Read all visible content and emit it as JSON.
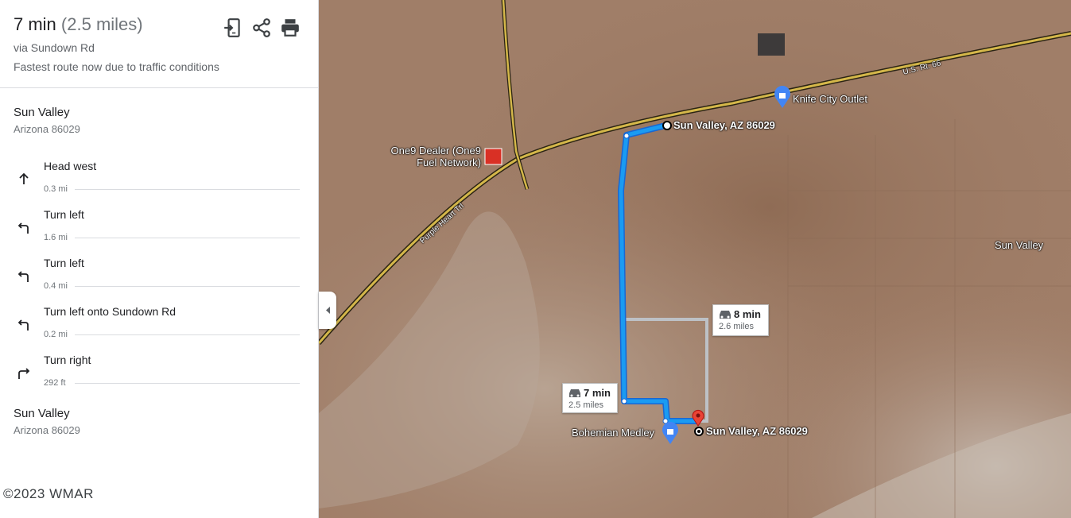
{
  "summary": {
    "time": "7 min",
    "distance": "(2.5 miles)",
    "via": "via Sundown Rd",
    "note": "Fastest route now due to traffic conditions"
  },
  "header_icons": [
    "send-to-phone-icon",
    "share-icon",
    "print-icon"
  ],
  "origin": {
    "name": "Sun Valley",
    "address": "Arizona 86029"
  },
  "steps": [
    {
      "icon": "arrow-up-icon",
      "instruction": "Head west",
      "distance": "0.3 mi"
    },
    {
      "icon": "turn-left-icon",
      "instruction": "Turn left",
      "distance": "1.6 mi"
    },
    {
      "icon": "turn-left-icon",
      "instruction": "Turn left",
      "distance": "0.4 mi"
    },
    {
      "icon": "turn-left-icon",
      "instruction": "Turn left onto Sundown Rd",
      "distance": "0.2 mi"
    },
    {
      "icon": "turn-right-icon",
      "instruction": "Turn right",
      "distance": "292 ft"
    }
  ],
  "destination": {
    "name": "Sun Valley",
    "address": "Arizona 86029"
  },
  "copyright": "©2023  WMAR",
  "map": {
    "labels": {
      "knife_city": "Knife City Outlet",
      "sun_valley_top": "Sun Valley, AZ 86029",
      "one9_line1": "One9 Dealer (One9",
      "one9_line2": "Fuel Network)",
      "sun_valley_area": "Sun Valley",
      "bohemian": "Bohemian Medley",
      "sun_valley_bottom": "Sun Valley, AZ 86029",
      "us66": "U.S. Rt. 66",
      "route66": "Purple Heart Trl"
    },
    "routes": {
      "alt": {
        "time": "8 min",
        "distance": "2.6 miles"
      },
      "main": {
        "time": "7 min",
        "distance": "2.5 miles"
      }
    },
    "colors": {
      "route": "#1a73e8",
      "alt_route": "#bdc1c6",
      "highway": "#d4b74a",
      "pin": "#ea4335"
    }
  }
}
